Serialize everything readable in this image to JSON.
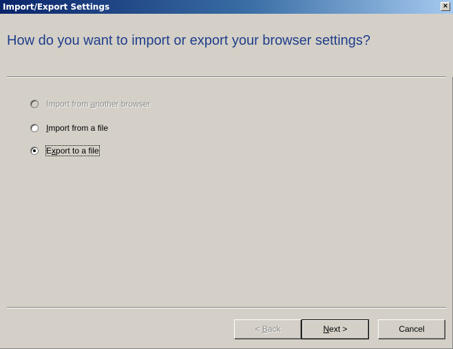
{
  "window": {
    "title": "Import/Export Settings",
    "close_glyph": "×"
  },
  "header": {
    "heading": "How do you want to import or export your browser settings?"
  },
  "options": [
    {
      "label_pre": "Import from ",
      "label_key": "a",
      "label_post": "nother browser",
      "selected": false,
      "enabled": false
    },
    {
      "label_pre": "",
      "label_key": "I",
      "label_post": "mport from a file",
      "selected": false,
      "enabled": true
    },
    {
      "label_pre": "E",
      "label_key": "x",
      "label_post": "port to a file",
      "selected": true,
      "enabled": true
    }
  ],
  "buttons": {
    "back": {
      "pre": "< ",
      "key": "B",
      "post": "ack",
      "enabled": false
    },
    "next": {
      "pre": "",
      "key": "N",
      "post": "ext >",
      "enabled": true
    },
    "cancel": {
      "label": "Cancel",
      "enabled": true
    }
  },
  "colors": {
    "face": "#d4d0c8",
    "heading": "#1f3d8a",
    "titlebar_start": "#0a246a",
    "titlebar_end": "#a6caf0"
  }
}
